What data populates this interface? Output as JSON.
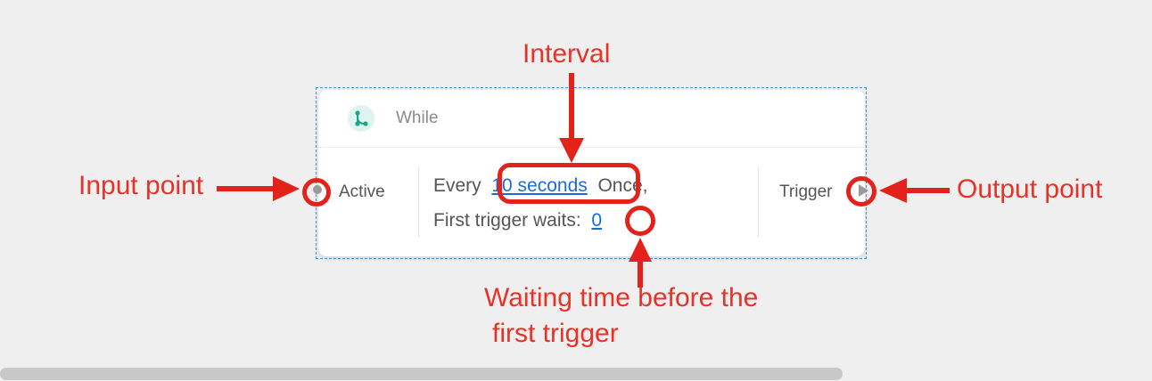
{
  "node": {
    "icon": "branch-icon",
    "title": "While",
    "input_label": "Active",
    "output_label": "Trigger",
    "line1_prefix": "Every",
    "interval_value": "10 seconds",
    "line1_suffix": "Once,",
    "line2_prefix": "First trigger waits:",
    "wait_value": "0"
  },
  "annotations": {
    "interval": "Interval",
    "input_point": "Input point",
    "output_point": "Output point",
    "wait_line1": "Waiting time before the",
    "wait_line2": "first trigger"
  },
  "colors": {
    "annotation": "#e3221b",
    "link": "#1a6bd8",
    "icon_accent": "#1aa88a"
  }
}
